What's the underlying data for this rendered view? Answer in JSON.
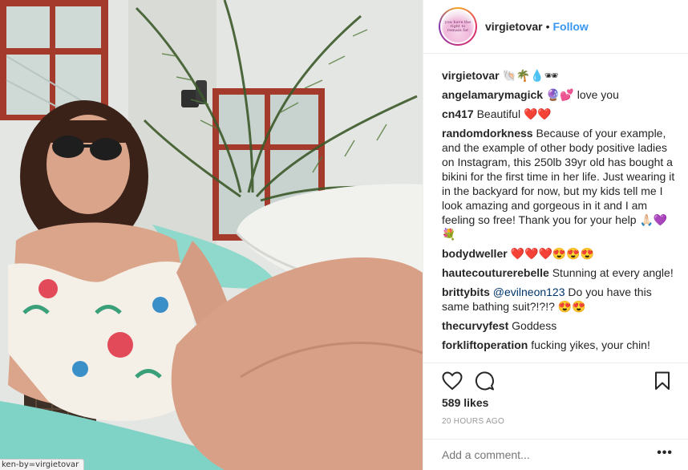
{
  "post": {
    "username": "virgietovar",
    "follow_label": "Follow",
    "separator": "•",
    "avatar_text": "you have the right to remain fat",
    "likes": "589 likes",
    "time": "20 HOURS AGO",
    "add_comment_placeholder": "Add a comment...",
    "more_options": "•••"
  },
  "photo": {
    "status_url": "ken-by=virgietovar"
  },
  "comments": [
    {
      "user": "virgietovar",
      "text": "🐚🌴💧🕶"
    },
    {
      "user": "angelamarymagick",
      "text": "🔮💕 love you"
    },
    {
      "user": "cn417",
      "text": "Beautiful ❤️❤️"
    },
    {
      "user": "randomdorkness",
      "text": "Because of your example, and the example of other body positive ladies on Instagram, this 250lb 39yr old has bought a bikini for the first time in her life. Just wearing it in the backyard for now, but my kids tell me I look amazing and gorgeous in it and I am feeling so free! Thank you for your help 🙏🏻💜💐"
    },
    {
      "user": "bodydweller",
      "text": "❤️❤️❤️😍😍😍"
    },
    {
      "user": "hautecouturerebelle",
      "text": "Stunning at every angle!"
    },
    {
      "user": "brittybits",
      "mention": "@evilneon123",
      "text": "Do you have this same bathing suit?!?!? 😍😍"
    },
    {
      "user": "thecurvyfest",
      "text": "Goddess"
    },
    {
      "user": "forkliftoperation",
      "text": "fucking yikes, your chin!"
    }
  ],
  "colors": {
    "link_blue": "#3897f0",
    "text": "#262626",
    "muted": "#999999",
    "border": "#efefef"
  },
  "icons": [
    "heart-icon",
    "comment-icon",
    "bookmark-icon",
    "more-options-icon"
  ]
}
